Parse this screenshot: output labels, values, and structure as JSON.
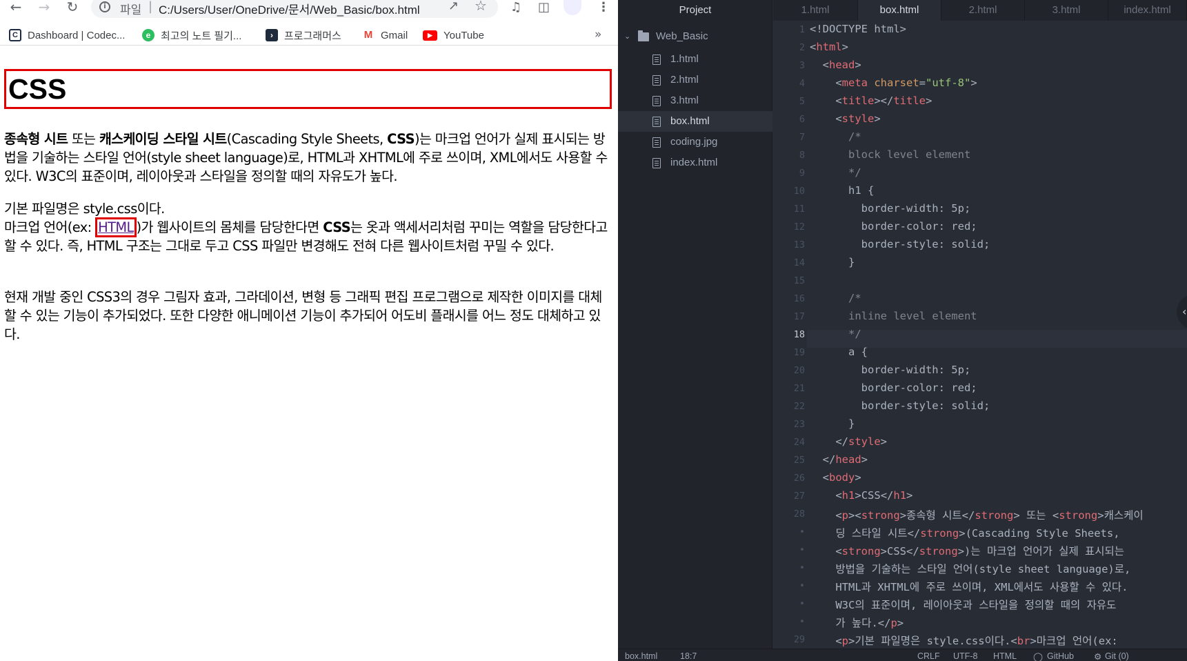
{
  "browser": {
    "address": {
      "scheme_label": "파일",
      "url": "C:/Users/User/OneDrive/문서/Web_Basic/box.html"
    },
    "bookmarks": [
      {
        "label": "Dashboard | Codec...",
        "icon": "codecademy-icon"
      },
      {
        "label": "최고의 노트 필기...",
        "icon": "evernote-icon"
      },
      {
        "label": "프로그래머스",
        "icon": "programmers-icon"
      },
      {
        "label": "Gmail",
        "icon": "gmail-icon"
      },
      {
        "label": "YouTube",
        "icon": "youtube-icon"
      }
    ],
    "bookmarks_more": "»"
  },
  "page": {
    "h1": "CSS",
    "p1": {
      "b1": "종속형 시트",
      "t1": " 또는 ",
      "b2": "캐스케이딩 스타일 시트",
      "t2": "(Cascading Style Sheets, ",
      "b3": "CSS",
      "t3": ")는 마크업 언어가 실제 표시되는 방법을 기술하는 스타일 언어(style sheet language)로, HTML과 XHTML에 주로 쓰이며, XML에서도 사용할 수 있다. W3C의 표준이며, 레이아웃과 스타일을 정의할 때의 자유도가 높다."
    },
    "p2": {
      "t1": "기본 파일명은 style.css이다.",
      "t2": "마크업 언어(ex: ",
      "link": "HTML",
      "t3": ")가 웹사이트의 몸체를 담당한다면 ",
      "b1": "CSS",
      "t4": "는 옷과 액세서리처럼 꾸미는 역할을 담당한다고 할 수 있다. 즉, HTML 구조는 그대로 두고 CSS 파일만 변경해도 전혀 다른 웹사이트처럼 꾸밀 수 있다."
    },
    "p3": "현재 개발 중인 CSS3의 경우 그림자 효과, 그라데이션, 변형 등 그래픽 편집 프로그램으로 제작한 이미지를 대체할 수 있는 기능이 추가되었다. 또한 다양한 애니메이션 기능이 추가되어 어도비 플래시를 어느 정도 대체하고 있다."
  },
  "editor": {
    "tree": {
      "title": "Project",
      "folder": "Web_Basic",
      "files": [
        "1.html",
        "2.html",
        "3.html",
        "box.html",
        "coding.jpg",
        "index.html"
      ],
      "selected": "box.html"
    },
    "tabs": [
      "1.html",
      "box.html",
      "2.html",
      "3.html",
      "index.html"
    ],
    "active_tab": "box.html",
    "line_numbers": [
      "1",
      "2",
      "3",
      "4",
      "5",
      "6",
      "7",
      "8",
      "9",
      "10",
      "11",
      "12",
      "13",
      "14",
      "15",
      "16",
      "17",
      "18",
      "19",
      "20",
      "21",
      "22",
      "23",
      "24",
      "25",
      "26",
      "27",
      "28",
      "•",
      "•",
      "•",
      "•",
      "•",
      "•",
      "29"
    ],
    "current_line": "18",
    "code": {
      "l1": "<!DOCTYPE html>",
      "t_html": "html",
      "t_head": "head",
      "t_meta": "meta",
      "attr_charset": "charset",
      "val_charset": "\"utf-8\"",
      "t_title": "title",
      "t_style": "style",
      "cmt_open": "/*",
      "cmt_block": "block level element",
      "cmt_inline": "inline level element",
      "cmt_close": "*/",
      "sel_h1": "h1 {",
      "sel_a": "a {",
      "prop1": "border-width: 5p;",
      "prop2": "border-color: red;",
      "prop3": "border-style: solid;",
      "close_brace": "}",
      "t_body": "body",
      "t_h1": "h1",
      "h1_text": "CSS",
      "t_p": "p",
      "t_strong": "strong",
      "t_br": "br",
      "w28_a": "종속형 시트",
      "w28_b": " 또는 ",
      "w28_c": "캐스케이",
      "w29_a": "딩 스타일 시트",
      "w29_b": "(Cascading Style Sheets,",
      "w30_a": "CSS",
      "w30_b": ")는 마크업 언어가 실제 표시되는",
      "w31": "방법을 기술하는 스타일 언어(style sheet language)로,",
      "w32": "HTML과 XHTML에 주로 쓰이며, XML에서도 사용할 수 있다.",
      "w33": "W3C의 표준이며, 레이아웃과 스타일을 정의할 때의 자유도",
      "w34": "가 높다.",
      "l29_a": "기본 파일명은 style.css이다.",
      "l29_b": "마크업 언어(ex:"
    },
    "status": {
      "file": "box.html",
      "cursor": "18:7",
      "eol": "CRLF",
      "encoding": "UTF-8",
      "grammar": "HTML",
      "github": "GitHub",
      "git": "Git (0)"
    }
  }
}
